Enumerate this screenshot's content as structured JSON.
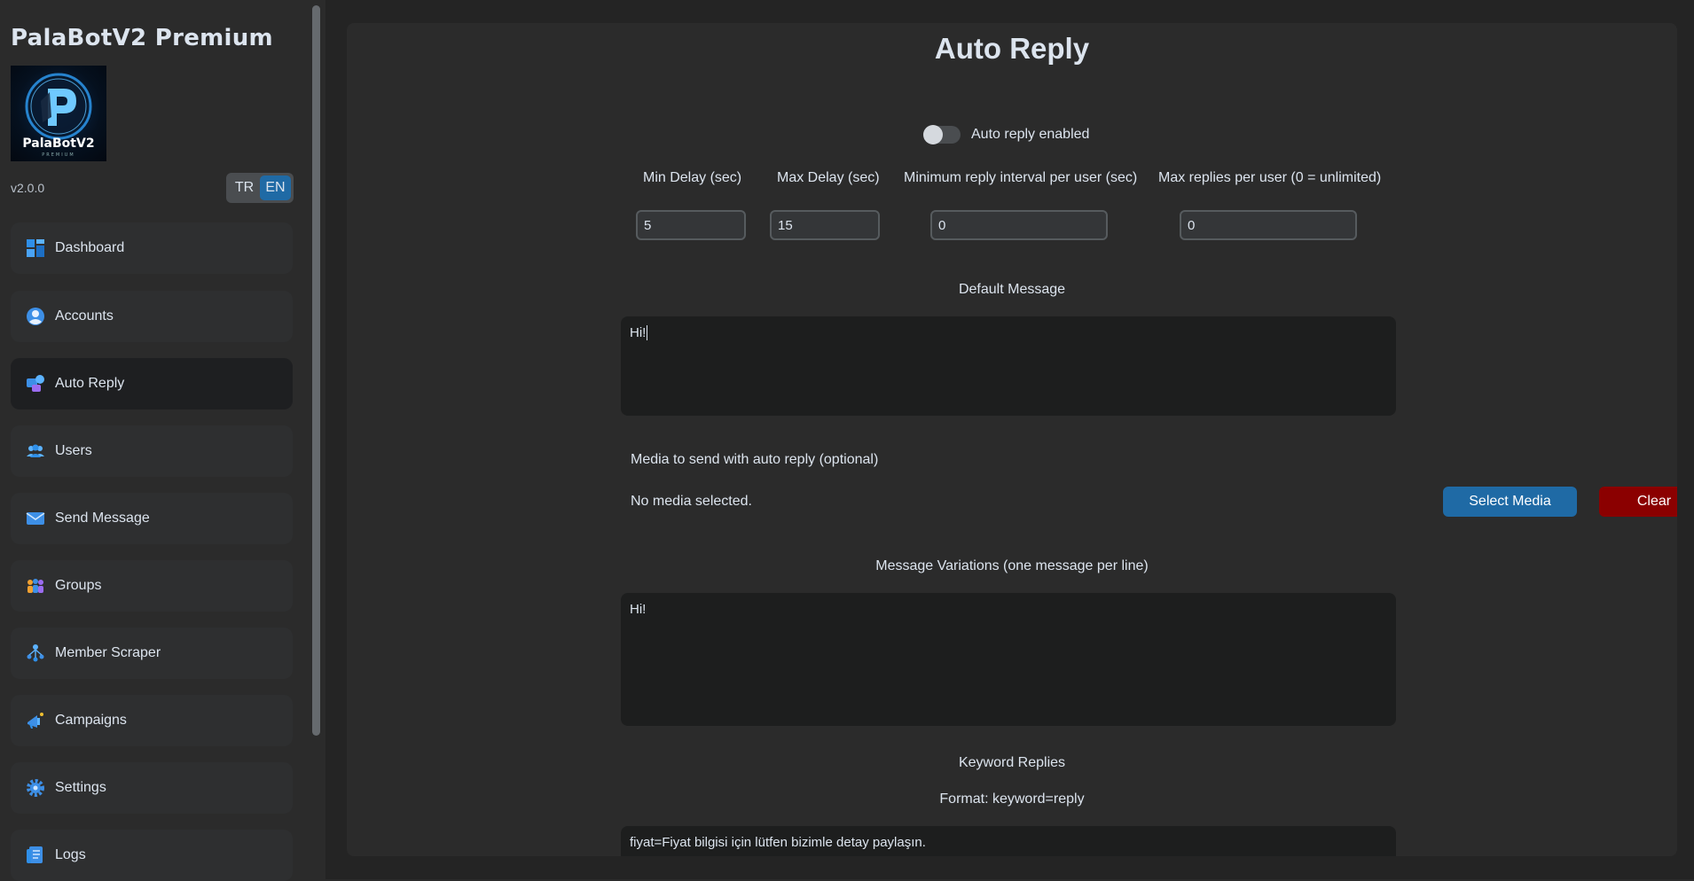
{
  "app": {
    "title": "PalaBotV2 Premium",
    "version": "v2.0.0",
    "logo_text": "PalaBotV2"
  },
  "language": {
    "options": [
      "TR",
      "EN"
    ],
    "selected": "EN"
  },
  "sidebar": {
    "items": [
      {
        "label": "Dashboard",
        "icon": "dashboard-icon"
      },
      {
        "label": "Accounts",
        "icon": "account-icon"
      },
      {
        "label": "Auto Reply",
        "icon": "auto-reply-icon",
        "active": true
      },
      {
        "label": "Users",
        "icon": "users-icon"
      },
      {
        "label": "Send Message",
        "icon": "envelope-icon"
      },
      {
        "label": "Groups",
        "icon": "groups-icon"
      },
      {
        "label": "Member Scraper",
        "icon": "scraper-icon"
      },
      {
        "label": "Campaigns",
        "icon": "campaign-icon"
      },
      {
        "label": "Settings",
        "icon": "gear-icon"
      },
      {
        "label": "Logs",
        "icon": "logs-icon"
      }
    ]
  },
  "page": {
    "title": "Auto Reply",
    "toggle": {
      "label": "Auto reply enabled",
      "enabled": false
    },
    "fields": {
      "min_delay": {
        "label": "Min Delay (sec)",
        "value": "5"
      },
      "max_delay": {
        "label": "Max Delay (sec)",
        "value": "15"
      },
      "min_interval": {
        "label": "Minimum reply interval per user (sec)",
        "value": "0"
      },
      "max_replies": {
        "label": "Max replies per user (0 = unlimited)",
        "value": "0"
      }
    },
    "default_message": {
      "label": "Default Message",
      "value": "Hi!"
    },
    "media": {
      "label": "Media to send with auto reply (optional)",
      "status": "No media selected.",
      "select_label": "Select Media",
      "clear_label": "Clear"
    },
    "variations": {
      "label": "Message Variations (one message per line)",
      "value": "Hi!"
    },
    "keywords": {
      "label": "Keyword Replies",
      "format_hint": "Format: keyword=reply",
      "value": "fiyat=Fiyat bilgisi için lütfen bizimle detay paylaşın."
    }
  },
  "colors": {
    "accent": "#1f6aa5",
    "danger": "#8b0000",
    "panel": "#2b2b2b",
    "background": "#242424"
  }
}
